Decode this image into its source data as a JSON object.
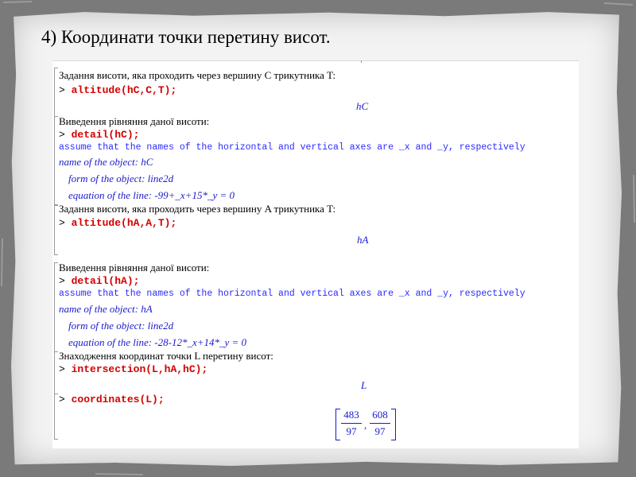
{
  "slide": {
    "title": "4) Координати точки перетину висот."
  },
  "worksheet": {
    "blocks": [
      {
        "comment": "Задання висоти, яка проходить через вершину C трикутника T:",
        "prompt": ">",
        "command": "altitude(hC,C,T);",
        "output": "hC"
      },
      {
        "comment": "Виведення рівняння даної висоти:",
        "prompt": ">",
        "command": "detail(hC);",
        "note": "assume that the names of the horizontal and vertical axes are _x and _y, respectively",
        "name_line": "name of the object:  hC",
        "form_line": "form of the object:  line2d",
        "equation_line": "equation of the line:  -99+_x+15*_y = 0"
      },
      {
        "comment": "Задання висоти, яка проходить через вершину A трикутника T:",
        "prompt": ">",
        "command": "altitude(hA,A,T);",
        "output": "hA"
      },
      {
        "comment": "Виведення рівняння даної висоти:",
        "prompt": ">",
        "command": "detail(hA);",
        "note": "assume that the names of the horizontal and vertical axes are _x and _y, respectively",
        "name_line": "name of the object:  hA",
        "form_line": "form of the object:  line2d",
        "equation_line": "equation of the line:  -28-12*_x+14*_y = 0"
      },
      {
        "comment": "Знаходження координат точки L перетину висот:",
        "prompt": ">",
        "command": "intersection(L,hA,hC);",
        "output": "L"
      },
      {
        "prompt": ">",
        "command": "coordinates(L);",
        "result": {
          "x_num": "483",
          "x_den": "97",
          "separator": ",",
          "y_num": "608",
          "y_den": "97"
        }
      }
    ]
  },
  "colors": {
    "command": "#d40000",
    "output": "#1a1acc",
    "note": "#2a2aff",
    "backdrop": "#7d7d7d",
    "paper": "#f3f3f3"
  }
}
